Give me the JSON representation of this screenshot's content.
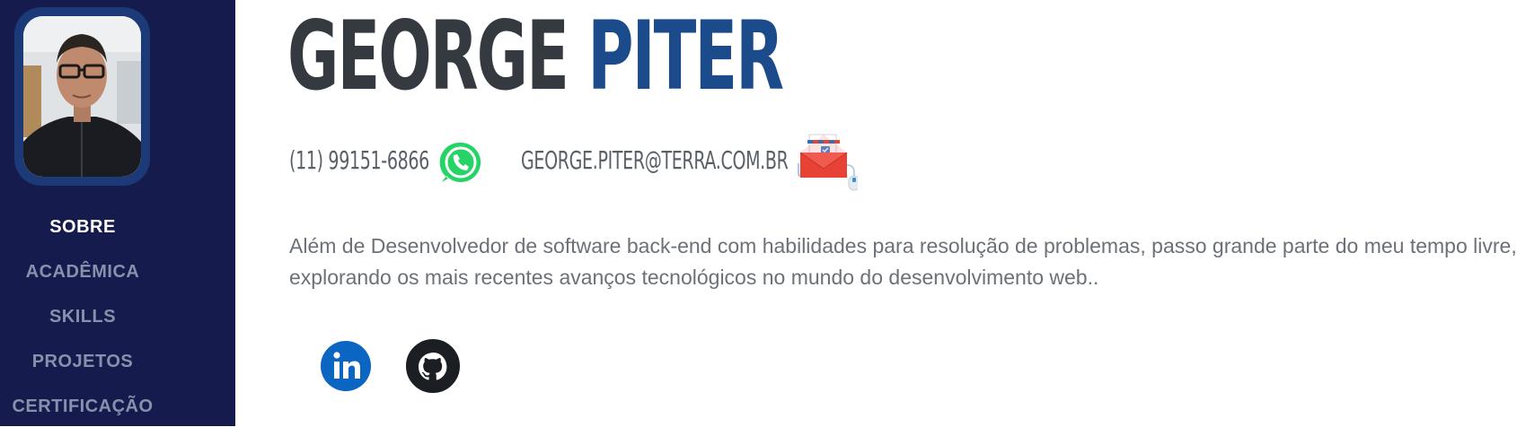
{
  "profile": {
    "first_name": "GEORGE",
    "last_name": "PITER",
    "avatar_icon": "profile-photo"
  },
  "sidebar": {
    "items": [
      {
        "label": "SOBRE",
        "active": true
      },
      {
        "label": "ACADÊMICA",
        "active": false
      },
      {
        "label": "SKILLS",
        "active": false
      },
      {
        "label": "PROJETOS",
        "active": false
      },
      {
        "label": "CERTIFICAÇÃO",
        "active": false
      }
    ]
  },
  "contact": {
    "phone": "(11) 99151-6866",
    "phone_icon": "whatsapp-icon",
    "email": "GEORGE.PITER@TERRA.COM.BR",
    "email_icon": "email-envelope-icon"
  },
  "about": {
    "text": "Além de Desenvolvedor de software back-end com habilidades para resolução de problemas, passo grande parte do meu tempo livre, explorando os mais recentes avanços tecnológicos no mundo do desenvolvimento web.."
  },
  "social": {
    "linkedin_icon": "linkedin-icon",
    "github_icon": "github-icon"
  },
  "colors": {
    "sidebar_bg": "#161b4d",
    "avatar_border": "#1c3a78",
    "name_dark": "#343a40",
    "name_accent": "#1b4b8a",
    "nav_inactive": "#8a8fac",
    "nav_active": "#ffffff",
    "body_text": "#6c7178",
    "whatsapp_green": "#25d366",
    "linkedin_blue": "#0a66c2"
  }
}
